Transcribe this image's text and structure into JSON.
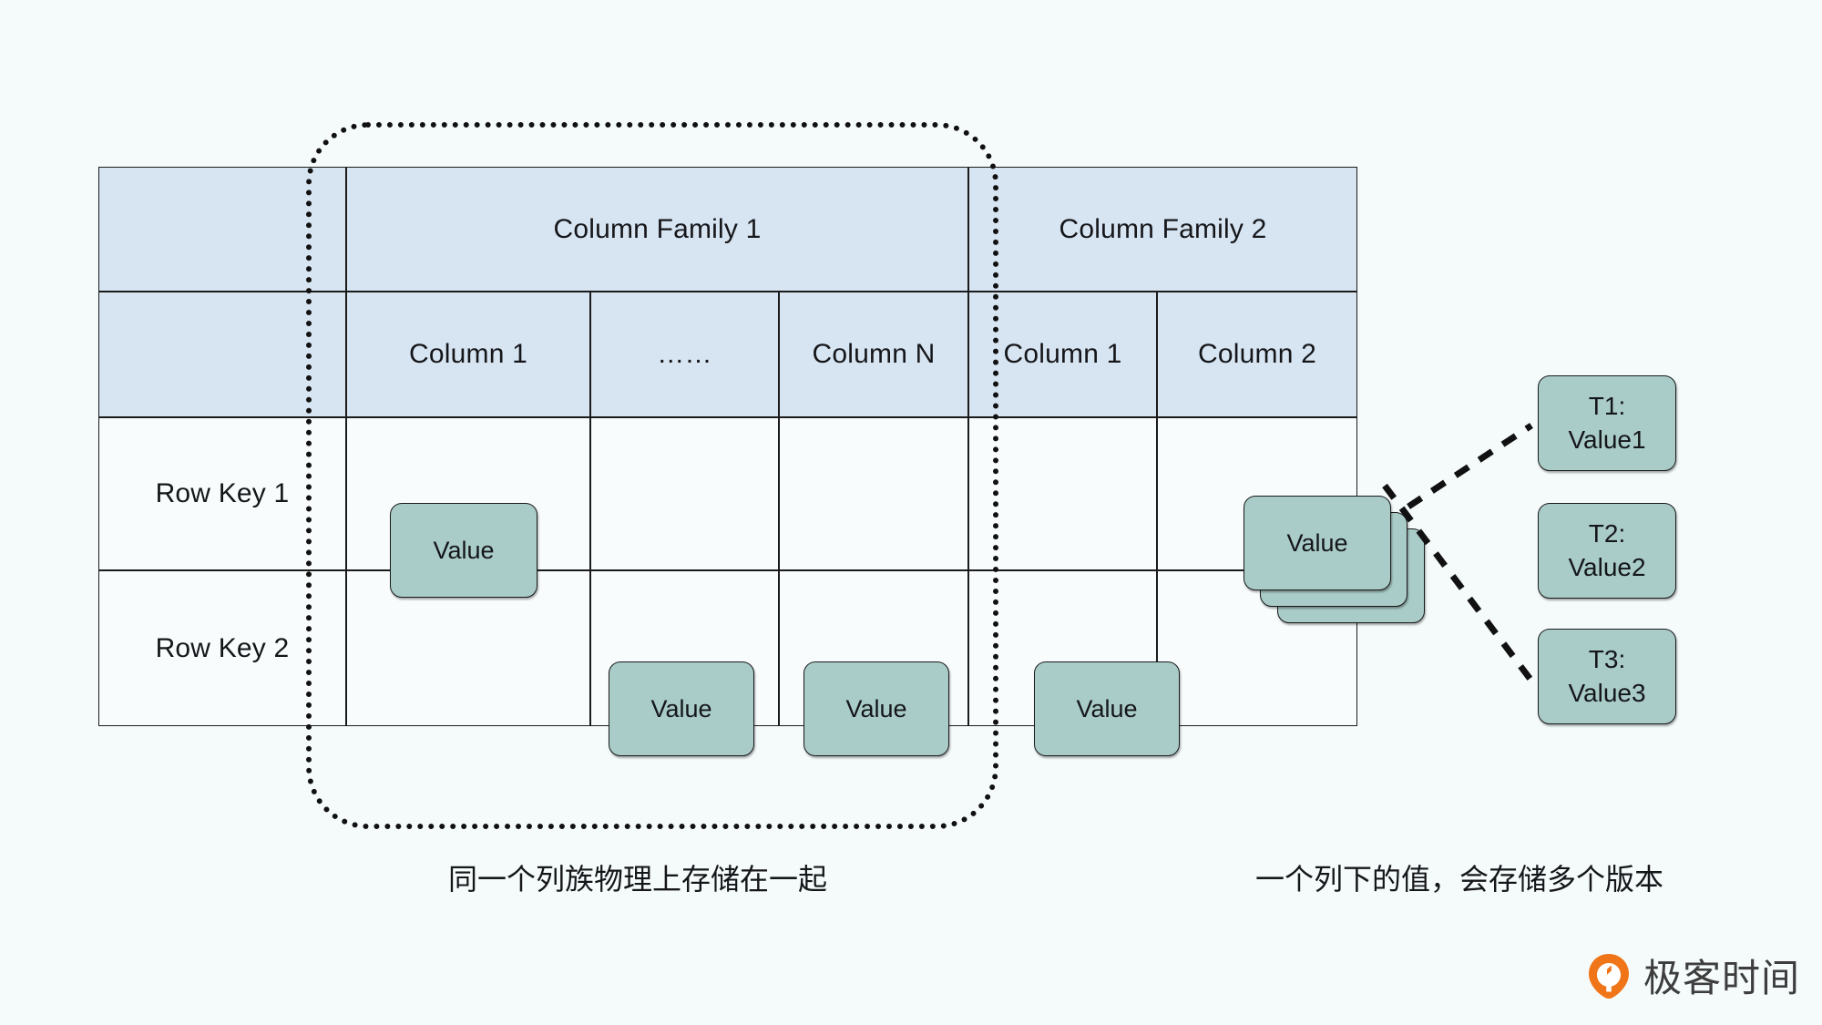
{
  "background_color": "#f5fbfb",
  "palette": {
    "header_blue": "#d7e4f1",
    "value_teal": "#a9ccc9",
    "line_black": "#1b1b1b",
    "brand_orange": "#ef7518"
  },
  "table": {
    "corner_label": "",
    "column_families": [
      {
        "label": "Column Family 1"
      },
      {
        "label": "Column Family 2"
      }
    ],
    "columns": [
      {
        "label": "Column 1"
      },
      {
        "label": "……"
      },
      {
        "label": "Column N"
      },
      {
        "label": "Column 1"
      },
      {
        "label": "Column 2"
      }
    ],
    "rows": [
      {
        "key": "Row Key 1"
      },
      {
        "key": "Row Key 2"
      }
    ],
    "value_label": "Value"
  },
  "versions": {
    "items": [
      {
        "time": "T1:",
        "value": "Value1"
      },
      {
        "time": "T2:",
        "value": "Value2"
      },
      {
        "time": "T3:",
        "value": "Value3"
      }
    ]
  },
  "captions": {
    "left": "同一个列族物理上存储在一起",
    "right": "一个列下的值，会存储多个版本"
  },
  "brand": {
    "name": "极客时间"
  }
}
